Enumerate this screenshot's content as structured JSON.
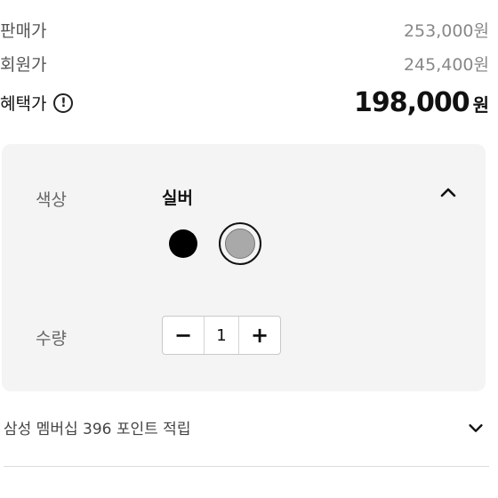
{
  "prices": {
    "sale_label": "판매가",
    "sale_value": "253,000원",
    "member_label": "회원가",
    "member_value": "245,400원",
    "benefit_label": "혜택가",
    "benefit_info_icon": "!",
    "benefit_value": "198,000",
    "benefit_unit": "원"
  },
  "options": {
    "color_label": "색상",
    "color_value": "실버",
    "swatches": [
      "black",
      "silver"
    ],
    "selected_swatch": "silver",
    "quantity_label": "수량",
    "quantity_value": "1",
    "decrement_symbol": "−",
    "increment_symbol": "+"
  },
  "points": {
    "text": "삼성 멤버십 396 포인트 적립"
  },
  "colors": {
    "panel_bg": "#f4f4f4",
    "swatch_black": "#000000",
    "swatch_silver": "#a9a9a9"
  }
}
